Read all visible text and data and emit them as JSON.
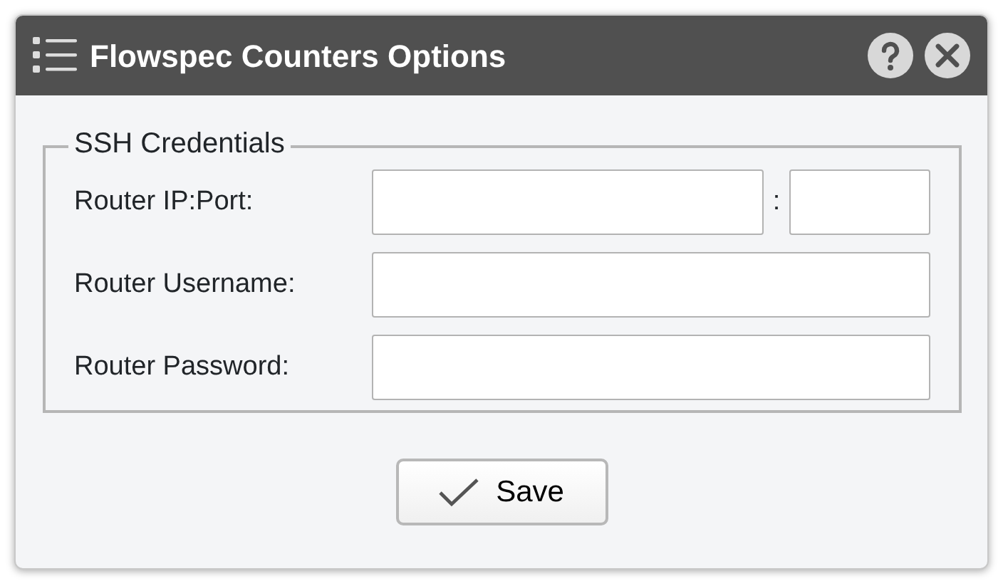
{
  "window": {
    "title": "Flowspec Counters Options"
  },
  "fieldset": {
    "legend": "SSH Credentials",
    "rows": [
      {
        "kind": "ipport",
        "label": "Router IP:Port:",
        "separator": ":"
      },
      {
        "kind": "text",
        "label": "Router Username:"
      },
      {
        "kind": "password",
        "label": "Router Password:"
      }
    ]
  },
  "buttons": [
    {
      "label": "Save"
    }
  ]
}
